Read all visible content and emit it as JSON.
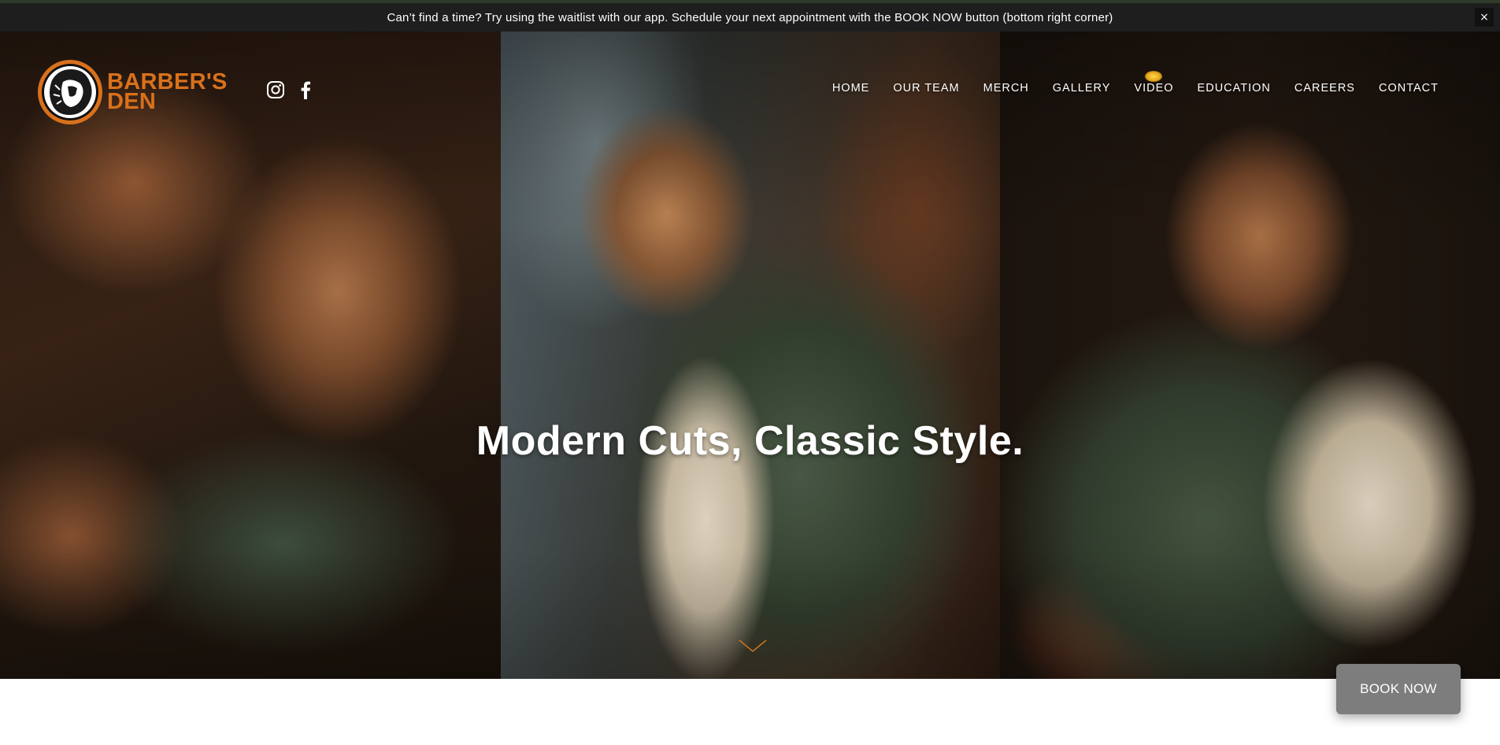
{
  "announcement": {
    "text": "Can’t find a time? Try using the waitlist with our app. Schedule your next appointment with the BOOK NOW button (bottom right corner)",
    "close_label": "×"
  },
  "brand": {
    "line1": "BARBER'S",
    "line2": "DEN",
    "color": "#d9711c"
  },
  "social": {
    "icons": [
      "instagram-icon",
      "facebook-icon"
    ]
  },
  "nav": {
    "items": [
      "HOME",
      "OUR TEAM",
      "MERCH",
      "GALLERY",
      "VIDEO",
      "EDUCATION",
      "CAREERS",
      "CONTACT"
    ]
  },
  "hero": {
    "title": "Modern Cuts, Classic Style."
  },
  "book_now": {
    "label": "BOOK NOW"
  }
}
